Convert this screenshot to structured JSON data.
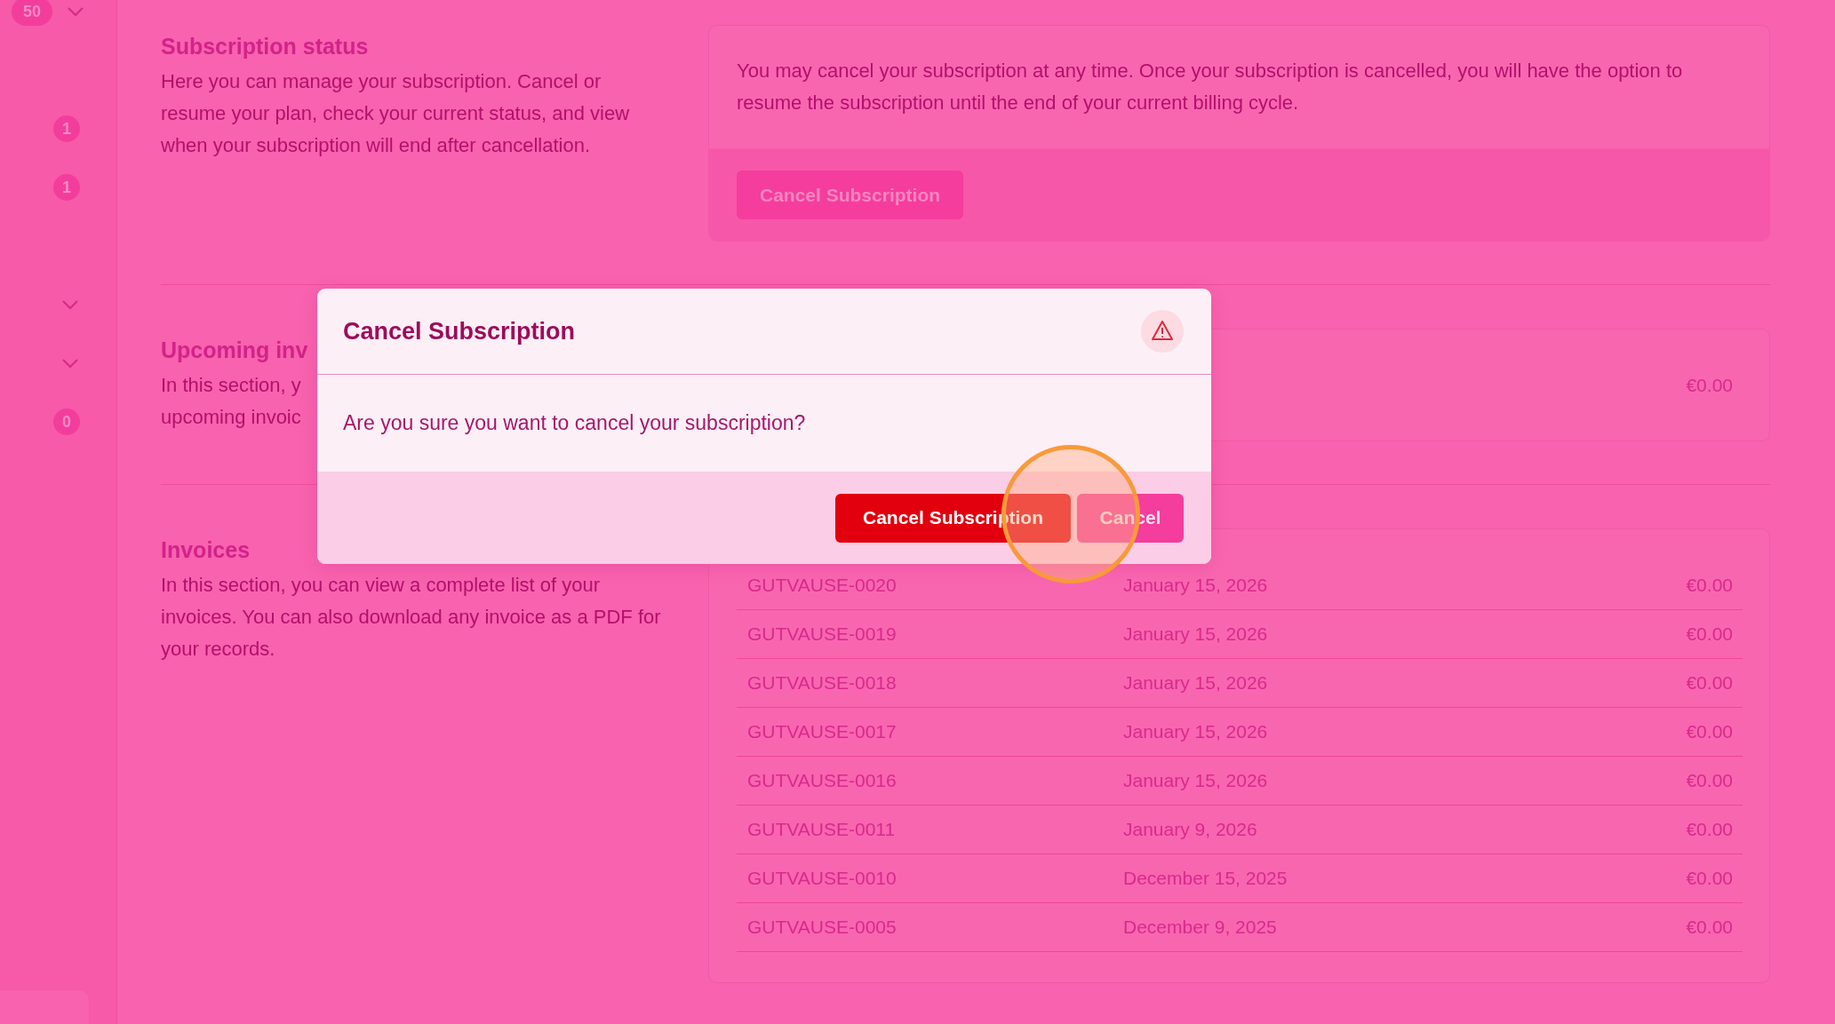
{
  "sidebar": {
    "items": [
      {
        "kind": "badge-chevron",
        "badge": "50"
      },
      {
        "kind": "blank"
      },
      {
        "kind": "badge",
        "badge": "1"
      },
      {
        "kind": "badge",
        "badge": "1"
      },
      {
        "kind": "blank"
      },
      {
        "kind": "chevron"
      },
      {
        "kind": "chevron"
      },
      {
        "kind": "badge",
        "badge": "0"
      }
    ]
  },
  "sections": [
    {
      "title": "Subscription status",
      "description": "Here you can manage your subscription. Cancel or resume your plan, check your current status, and view when your subscription will end after cancellation.",
      "card": {
        "kind": "notice",
        "text": "You may cancel your subscription at any time. Once your subscription is cancelled, you will have the option to resume the subscription until the end of your current billing cycle.",
        "button": "Cancel Subscription"
      }
    },
    {
      "title": "Upcoming inv",
      "description_lines": [
        "In this section, y",
        "upcoming invoic"
      ],
      "card": {
        "kind": "amount",
        "amount": "€0.00"
      }
    },
    {
      "title": "Invoices",
      "description": "In this section, you can view a complete list of your invoices. You can also download any invoice as a PDF for your records.",
      "card": {
        "kind": "table",
        "rows": [
          {
            "number": "GUTVAUSE-0020",
            "date": "January 15, 2026",
            "amount": "€0.00"
          },
          {
            "number": "GUTVAUSE-0019",
            "date": "January 15, 2026",
            "amount": "€0.00"
          },
          {
            "number": "GUTVAUSE-0018",
            "date": "January 15, 2026",
            "amount": "€0.00"
          },
          {
            "number": "GUTVAUSE-0017",
            "date": "January 15, 2026",
            "amount": "€0.00"
          },
          {
            "number": "GUTVAUSE-0016",
            "date": "January 15, 2026",
            "amount": "€0.00"
          },
          {
            "number": "GUTVAUSE-0011",
            "date": "January 9, 2026",
            "amount": "€0.00"
          },
          {
            "number": "GUTVAUSE-0010",
            "date": "December 15, 2025",
            "amount": "€0.00"
          },
          {
            "number": "GUTVAUSE-0005",
            "date": "December 9, 2025",
            "amount": "€0.00"
          }
        ]
      }
    }
  ],
  "dialog": {
    "title": "Cancel Subscription",
    "message": "Are you sure you want to cancel your subscription?",
    "buttons": [
      {
        "label": "Cancel Subscription",
        "kind": "danger"
      },
      {
        "label": "Cancel",
        "kind": "secondary"
      }
    ]
  }
}
